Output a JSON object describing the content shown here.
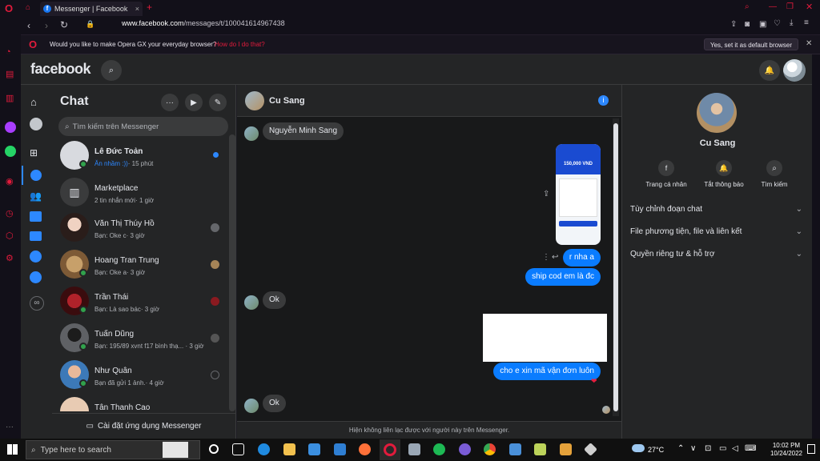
{
  "browser": {
    "tab_title": "Messenger | Facebook",
    "url_host": "www.facebook.com",
    "url_path": "/messages/t/100041614967438",
    "infobar_question": "Would you like to make Opera GX your everyday browser?",
    "infobar_link": "How do I do that?",
    "default_button": "Yes, set it as default browser"
  },
  "facebook": {
    "logo": "facebook"
  },
  "chat_panel": {
    "title": "Chat",
    "search_placeholder": "Tìm kiếm trên Messenger",
    "install_app": "Cài đặt ứng dụng Messenger",
    "conversations": [
      {
        "name": "Lê Đức Toản",
        "preview": "Ăn nhầm :))",
        "time": "· 15 phút",
        "online": true,
        "unread": true
      },
      {
        "name": "Marketplace",
        "preview": "2 tin nhắn mới",
        "time": "· 1 giờ",
        "online": false,
        "unread": false
      },
      {
        "name": "Văn Thị Thúy Hồ",
        "preview": "Bạn: Oke c",
        "time": "· 3 giờ",
        "online": false,
        "unread": false
      },
      {
        "name": "Hoang Tran Trung",
        "preview": "Bạn: Oke a",
        "time": "· 3 giờ",
        "online": true,
        "unread": false
      },
      {
        "name": "Trần Thái",
        "preview": "Bạn: Là sao bác",
        "time": "· 3 giờ",
        "online": true,
        "unread": false
      },
      {
        "name": "Tuấn Dũng",
        "preview": "Bạn: 195/89 xvnt f17 bình thạ...",
        "time": "· 3 giờ",
        "online": true,
        "unread": false
      },
      {
        "name": "Như Quân",
        "preview": "Bạn đã gửi 1 ảnh.",
        "time": "· 4 giờ",
        "online": true,
        "unread": false
      },
      {
        "name": "Tân Thanh Cao",
        "preview": "",
        "time": "",
        "online": false,
        "unread": false
      }
    ]
  },
  "conversation": {
    "contact_name": "Cu Sang",
    "messages": [
      {
        "from": "them",
        "text": "Nguyễn Minh Sang"
      },
      {
        "from": "me",
        "text": "r nha a"
      },
      {
        "from": "me",
        "text": "ship cod em là đc"
      },
      {
        "from": "them",
        "text": "Ok"
      },
      {
        "from": "me",
        "text": "cho e xin mã vận đơn luôn",
        "reaction": "❤"
      },
      {
        "from": "them",
        "text": "Ok"
      }
    ],
    "payment_image": {
      "amount": "150,000 VND"
    },
    "footer_notice": "Hiện không liên lạc được với người này trên Messenger."
  },
  "info_panel": {
    "name": "Cu Sang",
    "actions": [
      "Trang cá nhân",
      "Tắt thông báo",
      "Tìm kiếm"
    ],
    "sections": [
      "Tùy chỉnh đoạn chat",
      "File phương tiện, file và liên kết",
      "Quyền riêng tư & hỗ trợ"
    ]
  },
  "taskbar": {
    "search_placeholder": "Type here to search",
    "weather": "27°C",
    "time": "10:02 PM",
    "date": "10/24/2022"
  },
  "colors": {
    "opera_red": "#e21b3c",
    "messenger_blue": "#0a7cff",
    "fb_dark": "#242526"
  }
}
